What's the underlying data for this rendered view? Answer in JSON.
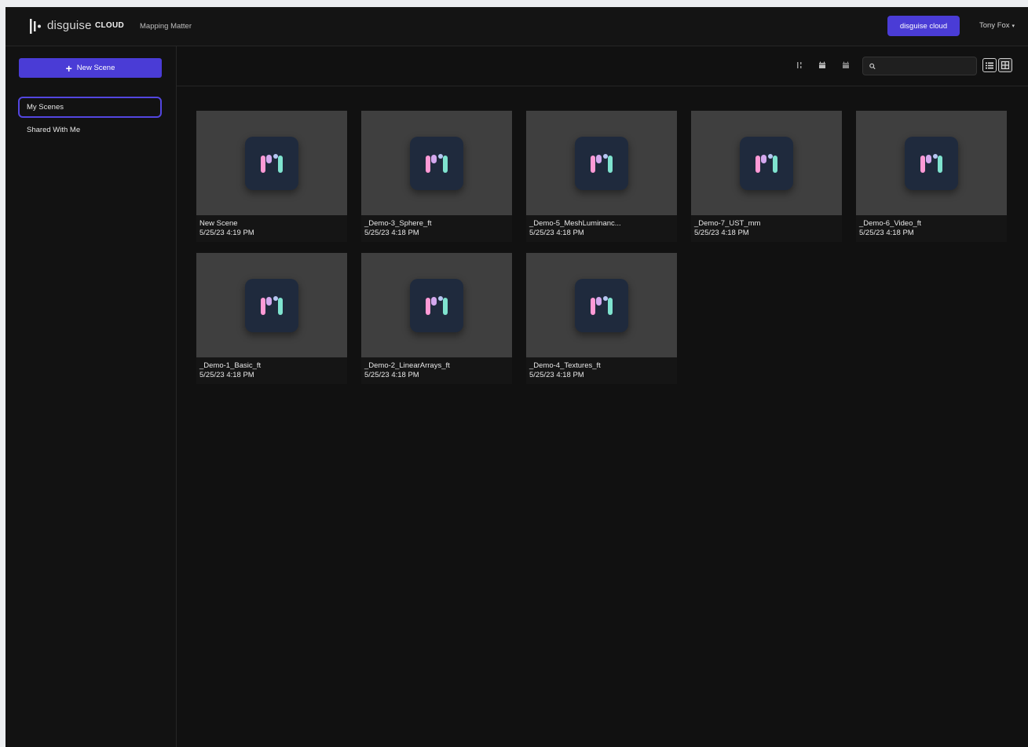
{
  "app": {
    "brand": "disguise",
    "brand_suffix": "CLOUD",
    "project_name": "Mapping Matter",
    "cloud_button_label": "disguise cloud",
    "user_name": "Tony Fox"
  },
  "colors": {
    "accent": "#4a3cd6",
    "background": "#111111",
    "thumbnail": "#3f3f3f",
    "tile": "#1f2a3d"
  },
  "sidebar": {
    "new_scene_label": "New Scene",
    "items": [
      {
        "label": "My Scenes",
        "active": true
      },
      {
        "label": "Shared With Me",
        "active": false
      }
    ]
  },
  "toolbar": {
    "icons": [
      "sort-icon",
      "calendar-icon",
      "calendar-alt-icon"
    ],
    "search_placeholder": "",
    "view_modes": [
      "list-view-icon",
      "grid-view-icon"
    ],
    "active_view": "grid"
  },
  "scenes": [
    {
      "name": "New Scene",
      "date": "5/25/23 4:19 PM"
    },
    {
      "name": "_Demo-3_Sphere_ft",
      "date": "5/25/23 4:18 PM"
    },
    {
      "name": "_Demo-5_MeshLuminanc...",
      "date": "5/25/23 4:18 PM"
    },
    {
      "name": "_Demo-7_UST_mm",
      "date": "5/25/23 4:18 PM"
    },
    {
      "name": "_Demo-6_Video_ft",
      "date": "5/25/23 4:18 PM"
    },
    {
      "name": "_Demo-1_Basic_ft",
      "date": "5/25/23 4:18 PM"
    },
    {
      "name": "_Demo-2_LinearArrays_ft",
      "date": "5/25/23 4:18 PM"
    },
    {
      "name": "_Demo-4_Textures_ft",
      "date": "5/25/23 4:18 PM"
    }
  ]
}
